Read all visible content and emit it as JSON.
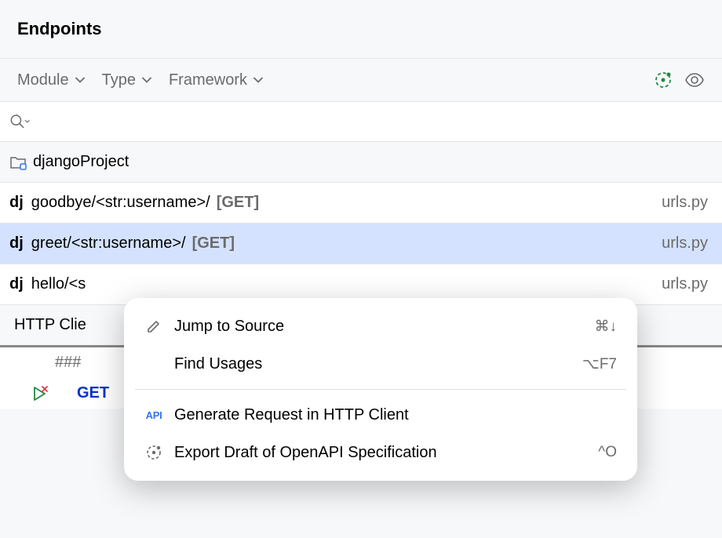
{
  "header": {
    "title": "Endpoints"
  },
  "toolbar": {
    "filters": [
      "Module",
      "Type",
      "Framework"
    ]
  },
  "project": {
    "name": "djangoProject"
  },
  "endpoints": [
    {
      "path": "goodbye/<str:username>/",
      "method": "[GET]",
      "file": "urls.py",
      "selected": false
    },
    {
      "path": "greet/<str:username>/",
      "method": "[GET]",
      "file": "urls.py",
      "selected": true
    },
    {
      "path": "hello/<s",
      "method": "",
      "file": "urls.py",
      "selected": false
    }
  ],
  "httpClient": {
    "label": "HTTP Clie",
    "line1": "###",
    "line2_method": "GET"
  },
  "contextMenu": {
    "items": [
      {
        "icon": "pencil",
        "label": "Jump to Source",
        "shortcut": "⌘↓"
      },
      {
        "icon": "",
        "label": "Find Usages",
        "shortcut": "⌥F7"
      },
      {
        "divider": true
      },
      {
        "icon": "api",
        "label": "Generate Request in HTTP Client",
        "shortcut": ""
      },
      {
        "icon": "gauge",
        "label": "Export Draft of OpenAPI Specification",
        "shortcut": "^O"
      }
    ]
  }
}
